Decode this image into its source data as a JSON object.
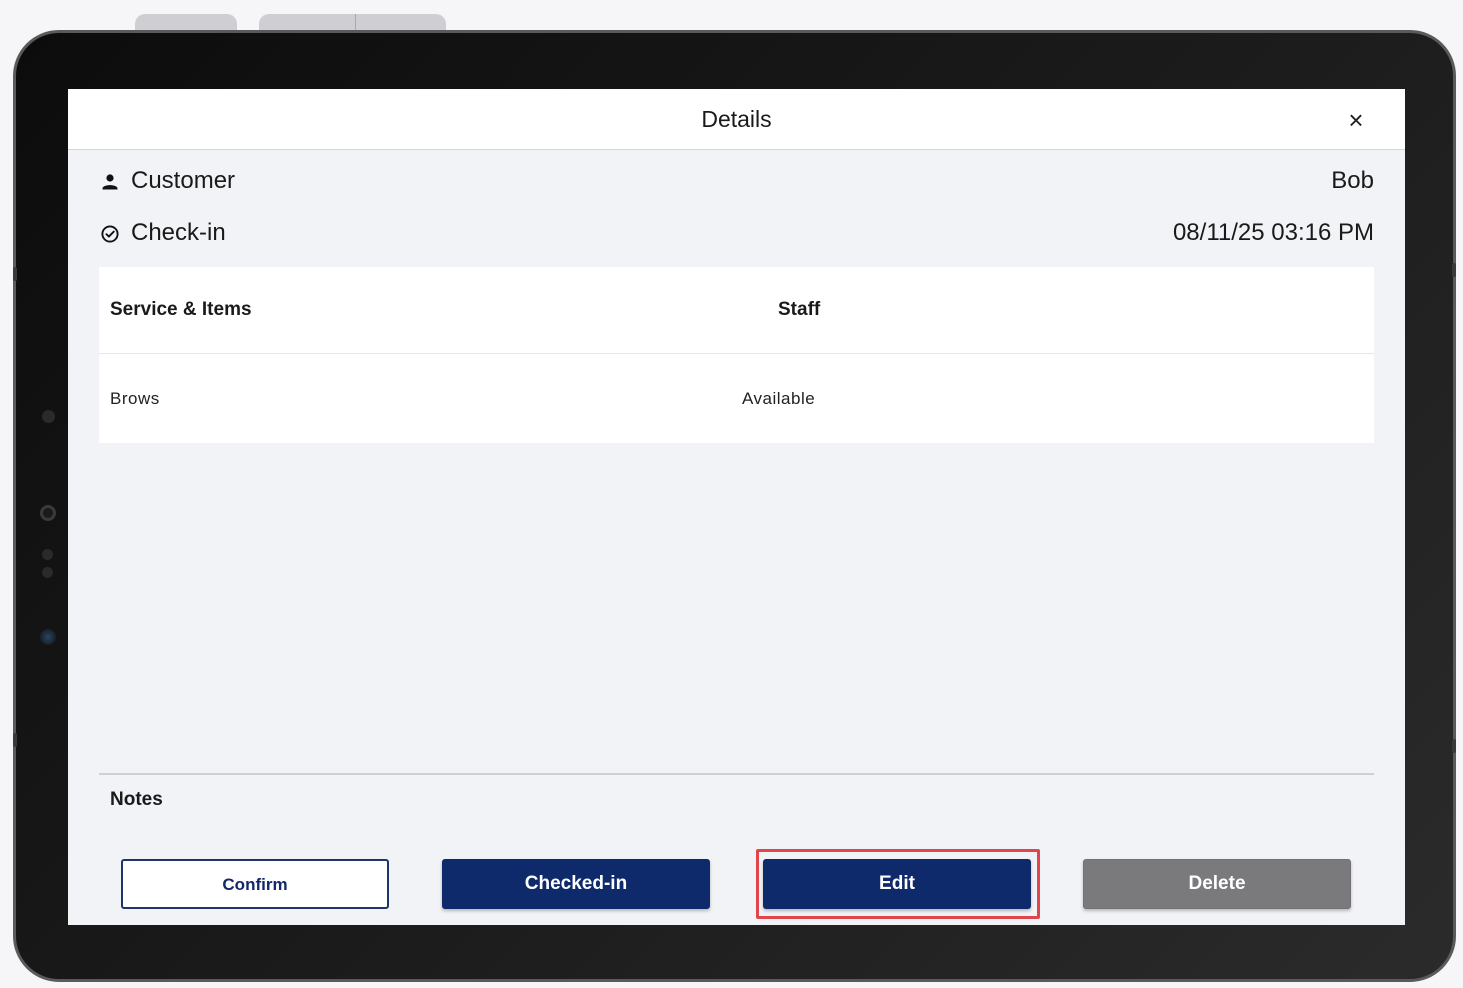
{
  "dialog": {
    "title": "Details",
    "close_icon": "close-icon"
  },
  "customer": {
    "icon": "person-icon",
    "label": "Customer",
    "value": "Bob"
  },
  "checkin": {
    "icon": "check-circle-icon",
    "label": "Check-in",
    "value": "08/11/25 03:16 PM"
  },
  "table": {
    "headers": [
      "Service & Items",
      "Staff"
    ],
    "rows": [
      {
        "service": "Brows",
        "staff": "Available"
      }
    ]
  },
  "notes": {
    "label": "Notes"
  },
  "actions": {
    "confirm_label": "Confirm",
    "checked_in_label": "Checked-in",
    "edit_label": "Edit",
    "delete_label": "Delete"
  },
  "colors": {
    "primary": "#0e2a6b",
    "delete": "#7a7a7c",
    "highlight": "#e2454b",
    "background": "#f2f3f7"
  }
}
